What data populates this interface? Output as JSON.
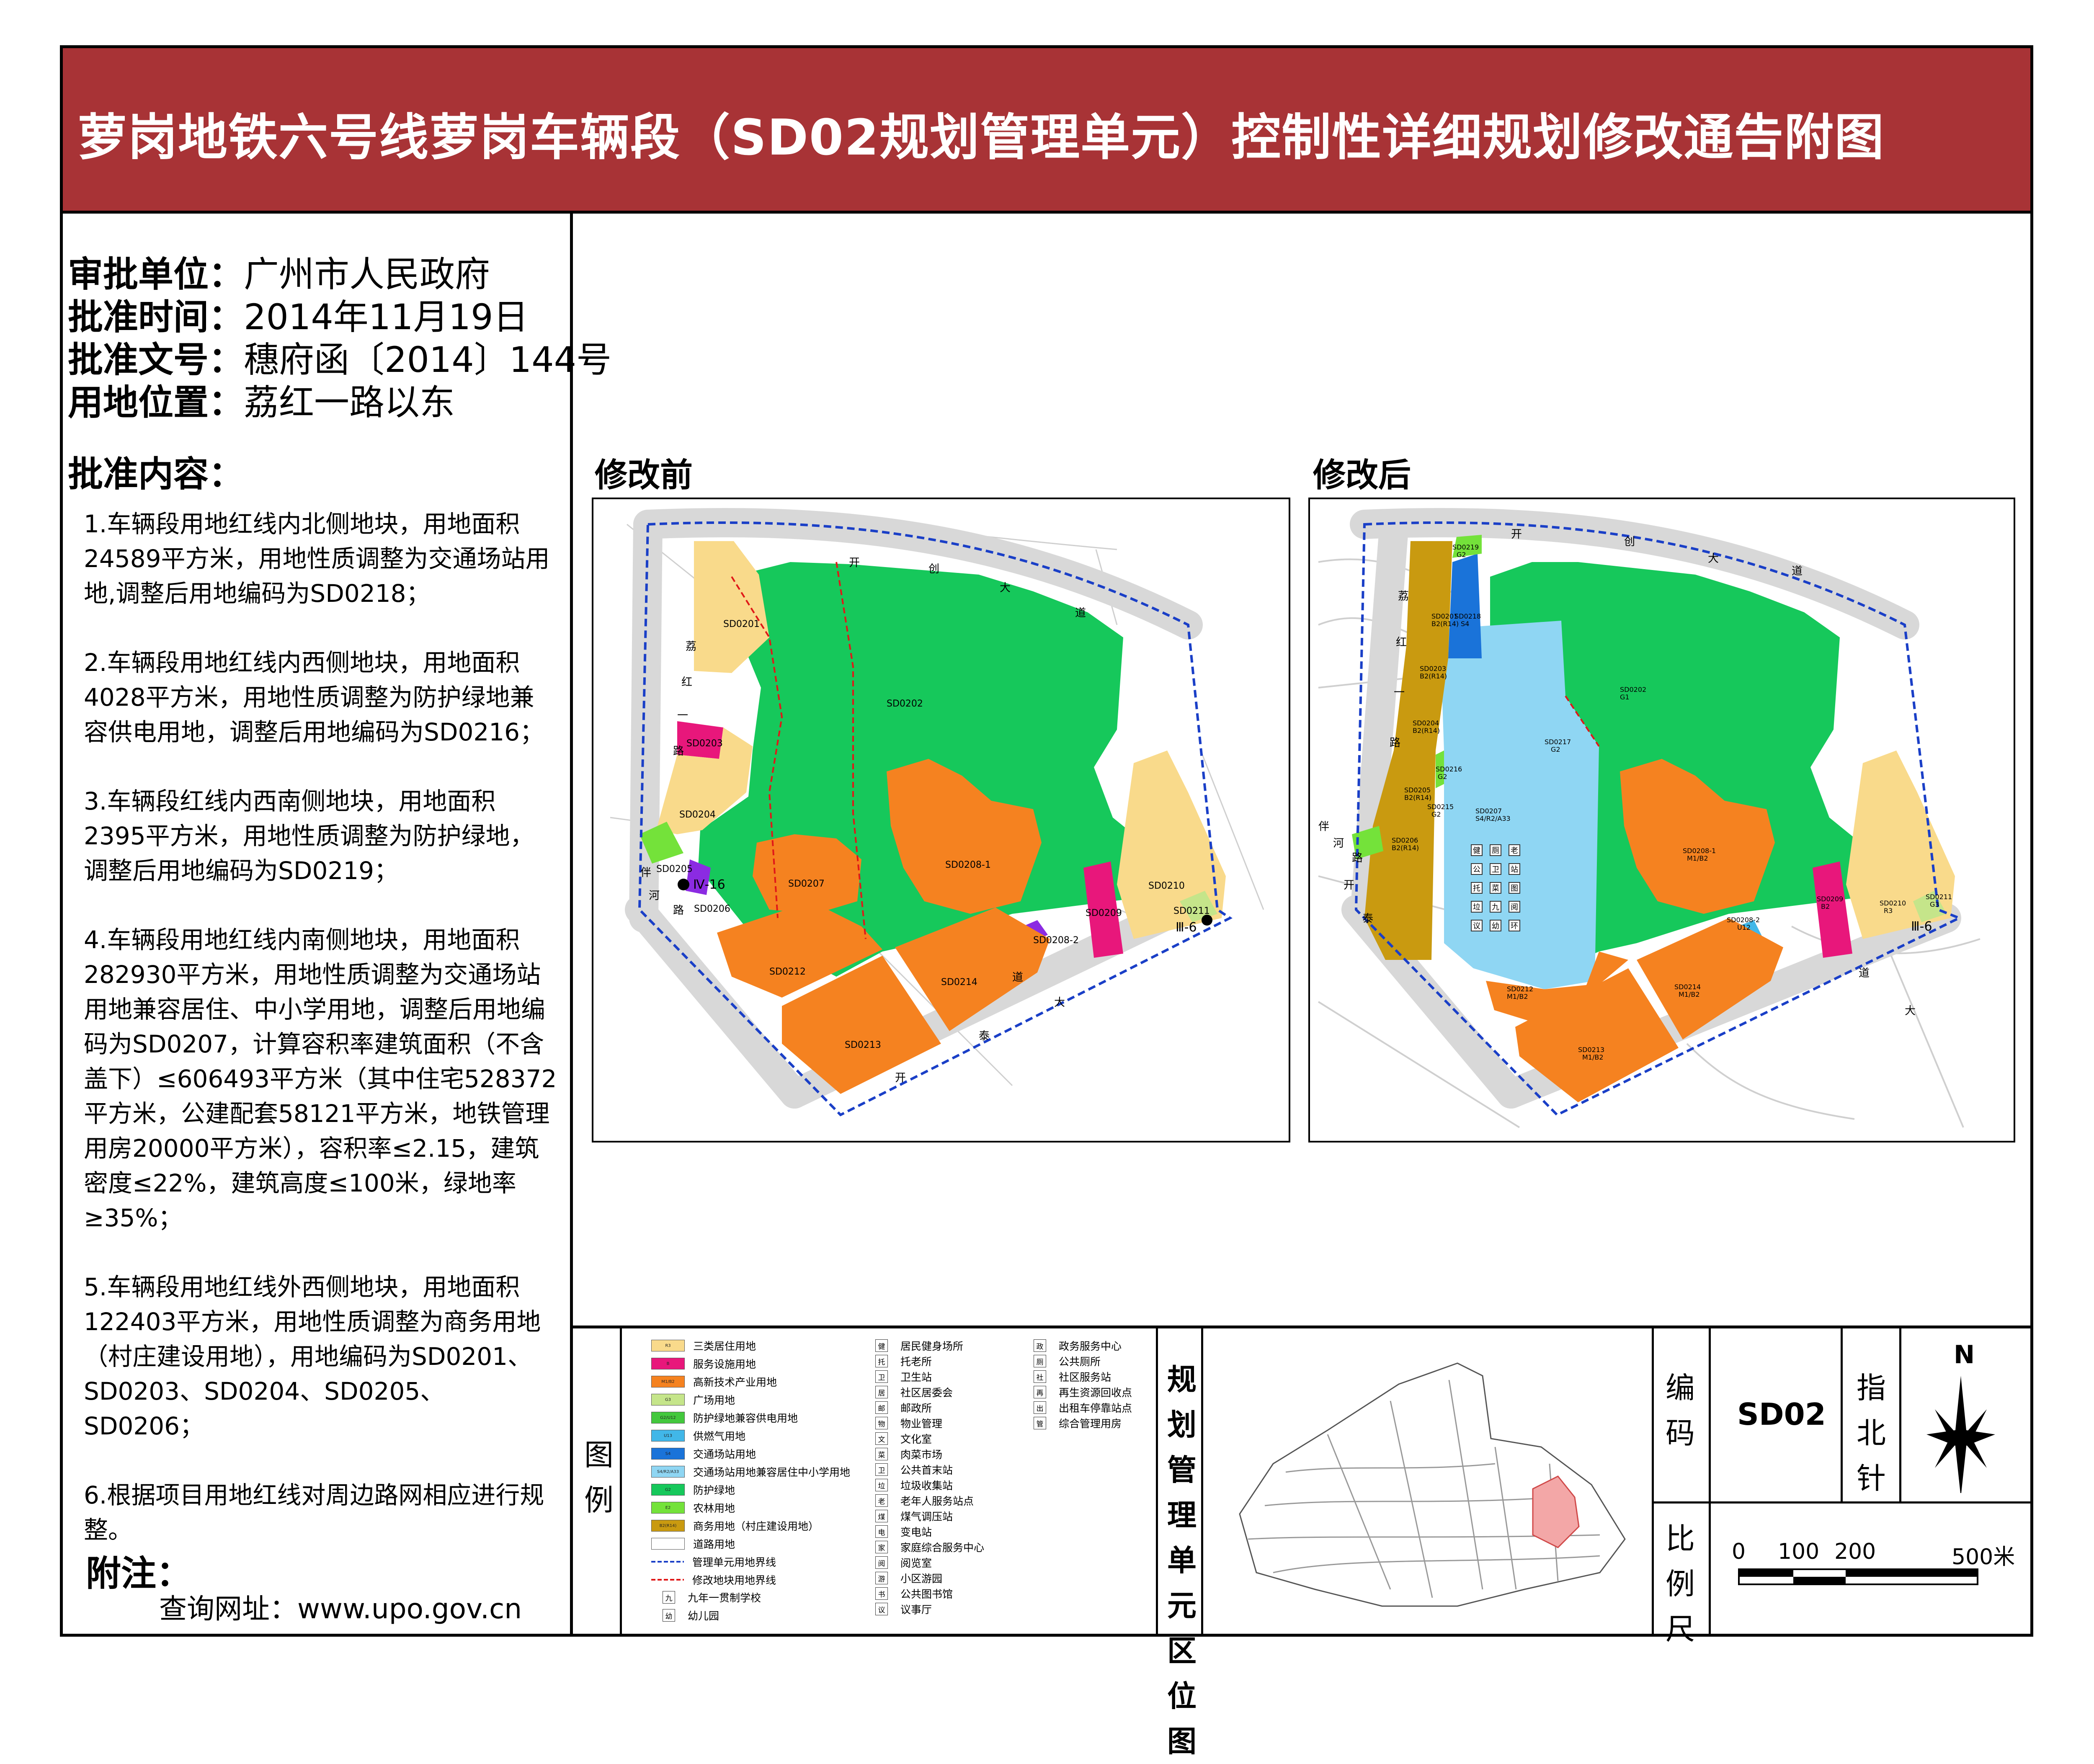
{
  "title": "萝岗地铁六号线萝岗车辆段（SD02规划管理单元）控制性详细规划修改通告附图",
  "meta": [
    {
      "label": "审批单位：",
      "value": "广州市人民政府"
    },
    {
      "label": "批准时间：",
      "value": "2014年11月19日"
    },
    {
      "label": "批准文号：",
      "value": "穗府函〔2014〕144号"
    },
    {
      "label": "用地位置：",
      "value": "荔红一路以东"
    }
  ],
  "content_heading": "批准内容：",
  "content": [
    "1.车辆段用地红线内北侧地块，用地面积24589平方米，用地性质调整为交通场站用地,调整后用地编码为SD0218；",
    "2.车辆段用地红线内西侧地块，用地面积4028平方米，用地性质调整为防护绿地兼容供电用地，调整后用地编码为SD0216；",
    "3.车辆段红线内西南侧地块，用地面积2395平方米，用地性质调整为防护绿地，调整后用地编码为SD0219；",
    "4.车辆段用地红线内南侧地块，用地面积282930平方米，用地性质调整为交通场站用地兼容居住、中小学用地，调整后用地编码为SD0207，计算容积率建筑面积（不含盖下）≤606493平方米（其中住宅528372平方米，公建配套58121平方米，地铁管理用房20000平方米），容积率≤2.15，建筑密度≤22%，建筑高度≤100米，绿地率≥35%；",
    "5.车辆段用地红线外西侧地块，用地面积122403平方米，用地性质调整为商务用地（村庄建设用地），用地编码为SD0201、SD0203、SD0204、SD0205、SD0206；",
    "6.根据项目用地红线对周边路网相应进行规整。"
  ],
  "note_label": "附注：",
  "note_url": "查询网址：www.upo.gov.cn",
  "maps": {
    "before": {
      "label": "修改前",
      "roads": [
        "开",
        "创",
        "大",
        "道",
        "荔",
        "红",
        "一",
        "路",
        "伴",
        "河",
        "路",
        "开",
        "泰",
        "大",
        "道"
      ],
      "parcels": [
        "SD0201",
        "SD0202",
        "SD0203",
        "SD0204",
        "SD0205",
        "SD0206",
        "SD0207",
        "SD0208-1",
        "SD0208-2",
        "SD0209",
        "SD0210",
        "SD0211",
        "SD0212",
        "SD0213",
        "SD0214"
      ],
      "markers": [
        "Ⅳ-16",
        "Ⅲ-6"
      ]
    },
    "after": {
      "label": "修改后",
      "roads": [
        "开",
        "创",
        "大",
        "道",
        "荔",
        "红",
        "一",
        "路",
        "伴",
        "河",
        "路",
        "开",
        "泰",
        "大",
        "道"
      ],
      "parcels": [
        {
          "code": "SD0201",
          "use": "B2(R14)"
        },
        {
          "code": "SD0202",
          "use": "G1"
        },
        {
          "code": "SD0203",
          "use": "B2(R14)"
        },
        {
          "code": "SD0204",
          "use": "B2(R14)"
        },
        {
          "code": "SD0205",
          "use": "B2(R14)"
        },
        {
          "code": "SD0206",
          "use": "B2(R14)"
        },
        {
          "code": "SD0207",
          "use": "S4/R2/A33"
        },
        {
          "code": "SD0208-1",
          "use": "M1/B2"
        },
        {
          "code": "SD0208-2",
          "use": "U12"
        },
        {
          "code": "SD0209",
          "use": "B2"
        },
        {
          "code": "SD0210",
          "use": "R3"
        },
        {
          "code": "SD0211",
          "use": "G3"
        },
        {
          "code": "SD0212",
          "use": "M1/B2"
        },
        {
          "code": "SD0213",
          "use": "M1/B2"
        },
        {
          "code": "SD0214",
          "use": "M1/B2"
        },
        {
          "code": "SD0215",
          "use": "G2"
        },
        {
          "code": "SD0216",
          "use": "G2"
        },
        {
          "code": "SD0217",
          "use": "G2"
        },
        {
          "code": "SD0218",
          "use": "S4"
        },
        {
          "code": "SD0219",
          "use": "G2"
        }
      ],
      "facility_icons": [
        "健",
        "厕",
        "老",
        "公",
        "卫",
        "站",
        "托",
        "菜",
        "图",
        "垃",
        "九",
        "阅",
        "议",
        "幼",
        "环"
      ],
      "markers": [
        "Ⅲ-6"
      ]
    }
  },
  "legend": {
    "label": "图例",
    "items": [
      {
        "code": "R3",
        "text": "三类居住用地",
        "color": "#f9da8b"
      },
      {
        "code": "B",
        "text": "服务设施用地",
        "color": "#e8177b"
      },
      {
        "code": "M1/B2",
        "text": "高新技术产业用地",
        "color": "#f58220"
      },
      {
        "code": "G3",
        "text": "广场用地",
        "color": "#c5e58a"
      },
      {
        "code": "G2/U12",
        "text": "防护绿地兼容供电用地",
        "color": "#43c83d"
      },
      {
        "code": "U13",
        "text": "供燃气用地",
        "color": "#41b7e8"
      },
      {
        "code": "S4",
        "text": "交通场站用地",
        "color": "#1a73d9"
      },
      {
        "code": "S4/R2/A33",
        "text": "交通场站用地兼容居住中小学用地",
        "color": "#8fd6f3"
      },
      {
        "code": "G2",
        "text": "防护绿地",
        "color": "#16c85b"
      },
      {
        "code": "E2",
        "text": "农林用地",
        "color": "#74e23a"
      },
      {
        "code": "B2(R14)",
        "text": "商务用地（村庄建设用地）",
        "color": "#c99a10"
      },
      {
        "code": "",
        "text": "道路用地",
        "color": "#ffffff"
      }
    ],
    "lines": [
      {
        "text": "管理单元用地界线",
        "color": "#1a3fc7"
      },
      {
        "text": "修改地块用地界线",
        "color": "#e01818"
      }
    ],
    "icons_left": [
      {
        "glyph": "九",
        "text": "九年一贯制学校"
      },
      {
        "glyph": "幼",
        "text": "幼儿园"
      }
    ],
    "icons_mid": [
      {
        "glyph": "健",
        "text": "居民健身场所"
      },
      {
        "glyph": "托",
        "text": "托老所"
      },
      {
        "glyph": "卫",
        "text": "卫生站"
      },
      {
        "glyph": "居",
        "text": "社区居委会"
      },
      {
        "glyph": "邮",
        "text": "邮政所"
      },
      {
        "glyph": "物",
        "text": "物业管理"
      },
      {
        "glyph": "文",
        "text": "文化室"
      },
      {
        "glyph": "菜",
        "text": "肉菜市场"
      },
      {
        "glyph": "卫",
        "text": "公共首末站"
      },
      {
        "glyph": "垃",
        "text": "垃圾收集站"
      },
      {
        "glyph": "老",
        "text": "老年人服务站点"
      },
      {
        "glyph": "煤",
        "text": "煤气调压站"
      },
      {
        "glyph": "电",
        "text": "变电站"
      },
      {
        "glyph": "家",
        "text": "家庭综合服务中心"
      },
      {
        "glyph": "阅",
        "text": "阅览室"
      },
      {
        "glyph": "游",
        "text": "小区游园"
      },
      {
        "glyph": "书",
        "text": "公共图书馆"
      },
      {
        "glyph": "议",
        "text": "议事厅"
      }
    ],
    "icons_right": [
      {
        "glyph": "政",
        "text": "政务服务中心"
      },
      {
        "glyph": "厕",
        "text": "公共厕所"
      },
      {
        "glyph": "社",
        "text": "社区服务站"
      },
      {
        "glyph": "再",
        "text": "再生资源回收点"
      },
      {
        "glyph": "出",
        "text": "出租车停靠站点"
      },
      {
        "glyph": "管",
        "text": "综合管理用房"
      }
    ]
  },
  "location_map_label": "规划管理单元区位图",
  "code_label": "编码",
  "code_value": "SD02",
  "north_label": "指北针",
  "north_letter": "N",
  "scale_label": "比例尺",
  "scale_ticks": [
    "0",
    "100",
    "200",
    "500米"
  ],
  "colors": {
    "title_bg": "#a83336",
    "R3": "#f9da8b",
    "G2": "#16c85b",
    "M1B2": "#f58220",
    "B": "#e8177b",
    "S4R2": "#8fd6f3",
    "S4": "#1a73d9",
    "B2R14": "#c99a10",
    "E2": "#74e23a",
    "U12": "#8b2be2"
  }
}
